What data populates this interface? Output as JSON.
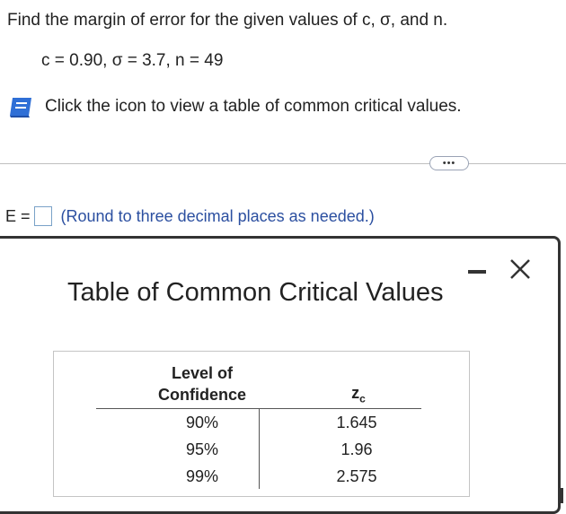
{
  "question": "Find the margin of error for the given values of c, σ, and n.",
  "given_values": "c = 0.90, σ = 3.7, n = 49",
  "hint_text": "Click the icon to view a table of common critical values.",
  "expand_label": "•••",
  "answer": {
    "label": "E =",
    "value": "",
    "note": "(Round to three decimal places as needed.)"
  },
  "dialog": {
    "title": "Table of Common Critical Values",
    "table": {
      "header_confidence": "Level of Confidence",
      "header_z": "z",
      "header_z_sub": "c",
      "rows": [
        {
          "confidence": "90%",
          "z": "1.645"
        },
        {
          "confidence": "95%",
          "z": "1.96"
        },
        {
          "confidence": "99%",
          "z": "2.575"
        }
      ]
    }
  },
  "colors": {
    "icon_blue": "#2f6fd6",
    "note_blue": "#2b4fa0",
    "dialog_border": "#333333"
  }
}
